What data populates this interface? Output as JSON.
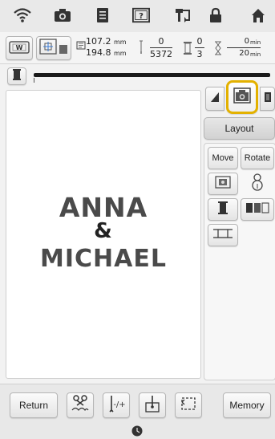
{
  "status_bar": {
    "icons": [
      "wifi-icon",
      "camera-icon",
      "document-icon",
      "help-icon",
      "thread-icon",
      "lock-icon",
      "home-icon"
    ]
  },
  "info_bar": {
    "width": "107.2",
    "height": "194.8",
    "size_unit": "mm",
    "stitch_current": "0",
    "stitch_total": "5372",
    "color_current": "0",
    "color_total": "3",
    "time_current": "0",
    "time_total": "20",
    "time_unit": "min"
  },
  "design": {
    "lines": [
      "ANNA",
      "&",
      "MICHAEL"
    ],
    "color": "#4a4a4a"
  },
  "tabs": {
    "active_tab_highlight_color": "#e3b100"
  },
  "layout_label": "Layout",
  "side_panel": {
    "move_label": "Move",
    "rotate_label": "Rotate"
  },
  "bottom": {
    "return_label": "Return",
    "memory_label": "Memory"
  },
  "colors": {
    "progress_fill": "#1a1a1a",
    "progress_track": "#d0d0d0"
  }
}
